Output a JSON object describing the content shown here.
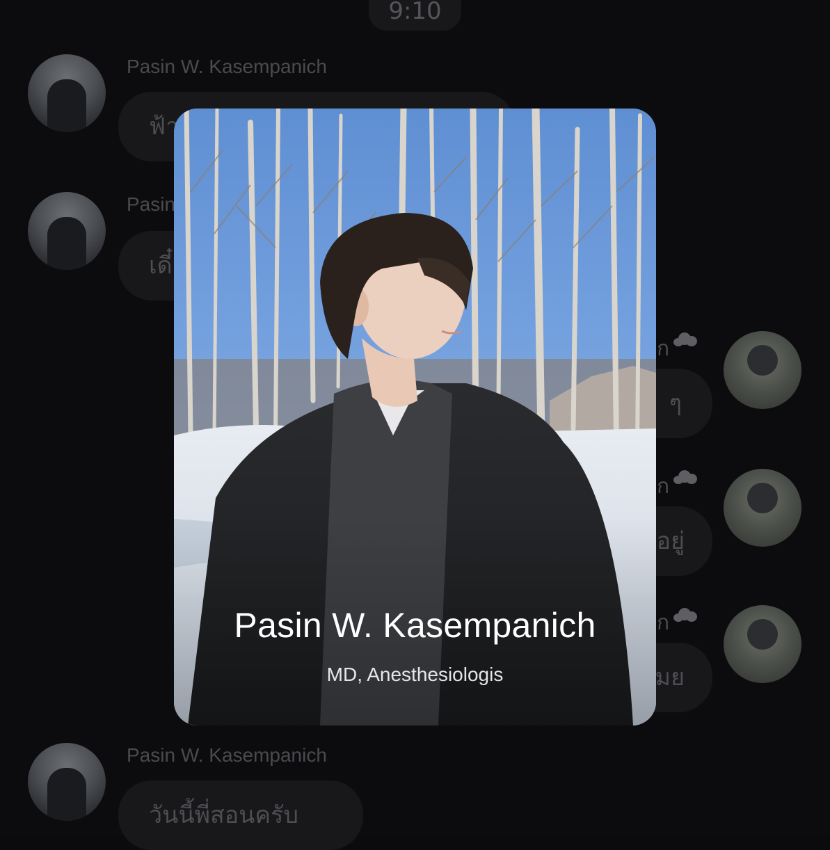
{
  "chat": {
    "time_pill": "9:10",
    "messages": [
      {
        "sender": "Pasin W. Kasempanich",
        "text": "ฟ้า"
      },
      {
        "sender": "Pasin",
        "text": "เดี๋"
      },
      {
        "sender": "Pasin W. Kasempanich",
        "text": "วันนี้พี่สอนครับ"
      }
    ],
    "right_messages": [
      {
        "stub": "ก",
        "text": "ๆ"
      },
      {
        "stub": "ก",
        "text": "อยู่"
      },
      {
        "stub": "ก",
        "text": "มย"
      }
    ]
  },
  "profile_card": {
    "name": "Pasin W. Kasempanich",
    "title": "MD, Anesthesiologis"
  },
  "icons": {
    "cloud": "cloud-icon",
    "avatar_left": "avatar-pasin",
    "avatar_right": "avatar-user"
  }
}
